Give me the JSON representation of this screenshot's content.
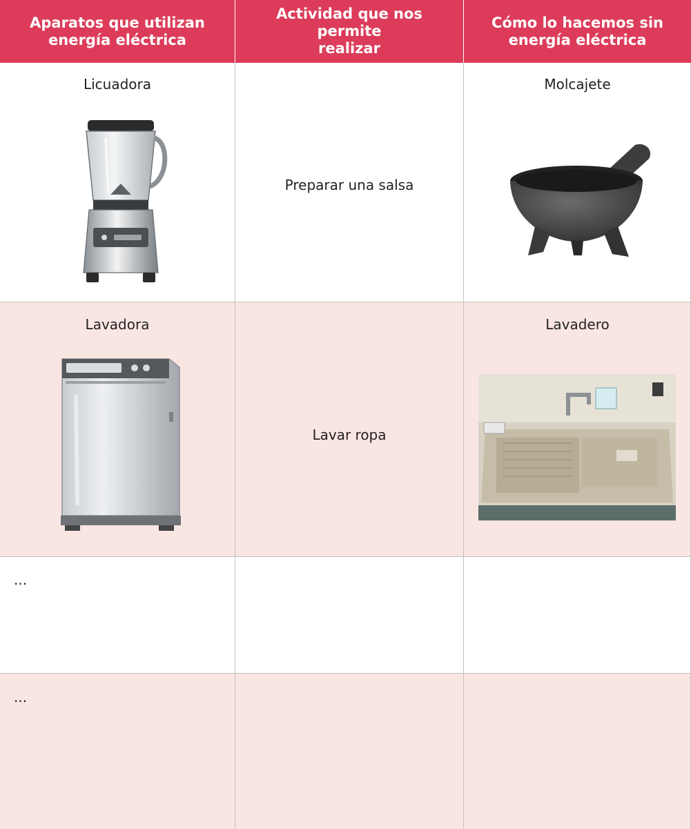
{
  "header": {
    "col1": "Aparatos que utilizan\nenergía eléctrica",
    "col2": "Actividad que nos permite\nrealizar",
    "col3": "Cómo lo hacemos sin\nenergía eléctrica"
  },
  "rows": [
    {
      "appliance": "Licuadora",
      "activity": "Preparar una salsa",
      "alternative": "Molcajete",
      "appliance_icon": "blender-image",
      "alternative_icon": "molcajete-image"
    },
    {
      "appliance": "Lavadora",
      "activity": "Lavar ropa",
      "alternative": "Lavadero",
      "appliance_icon": "washing-machine-image",
      "alternative_icon": "washboard-sink-image"
    },
    {
      "appliance": "...",
      "activity": "",
      "alternative": ""
    },
    {
      "appliance": "...",
      "activity": "",
      "alternative": ""
    }
  ],
  "colors": {
    "header": "#dc3c5a",
    "row_alt": "#f9e6e3",
    "grid": "#c5c0c0"
  }
}
